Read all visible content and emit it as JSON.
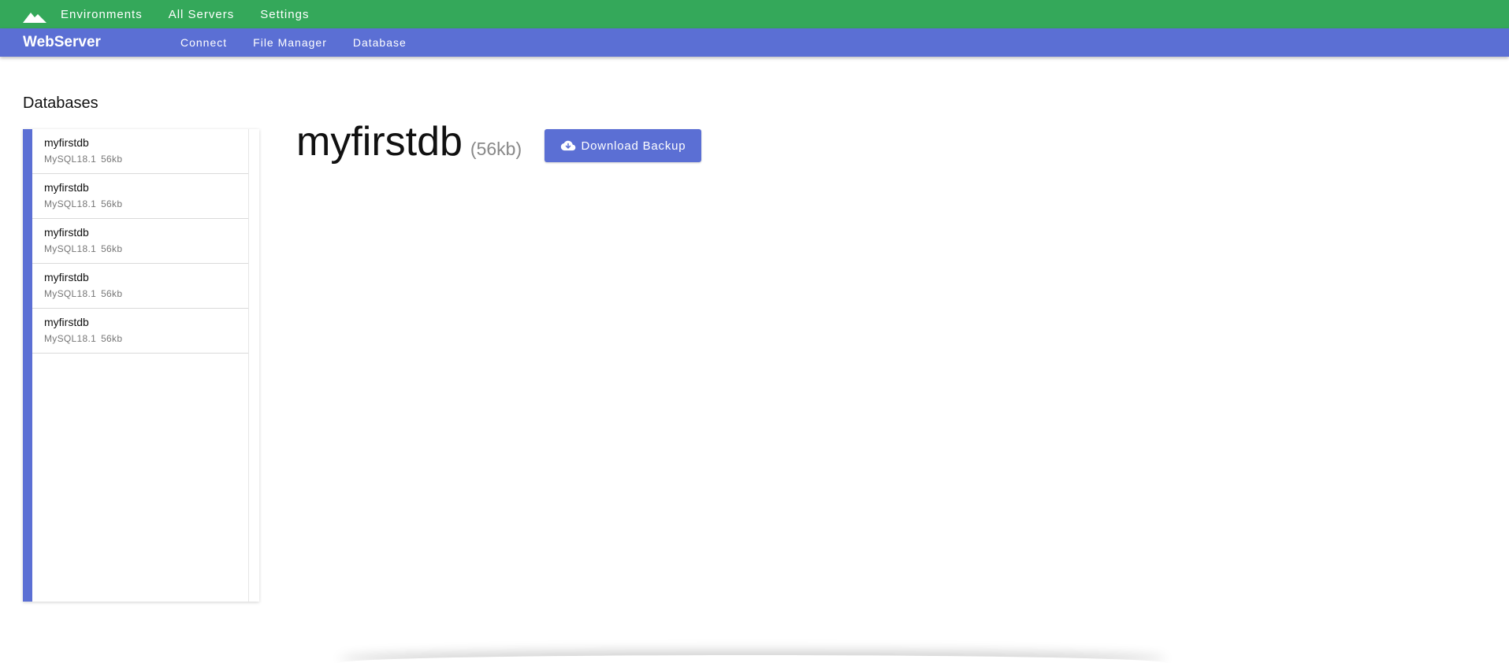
{
  "topbar": {
    "logo_icon": "mountain-icon",
    "nav": [
      "Environments",
      "All Servers",
      "Settings"
    ]
  },
  "subbar": {
    "brand": "WebServer",
    "nav": [
      "Connect",
      "File Manager",
      "Database"
    ]
  },
  "sidebar": {
    "title": "Databases",
    "items": [
      {
        "name": "myfirstdb",
        "engine": "MySQL18.1",
        "size": "56kb"
      },
      {
        "name": "myfirstdb",
        "engine": "MySQL18.1",
        "size": "56kb"
      },
      {
        "name": "myfirstdb",
        "engine": "MySQL18.1",
        "size": "56kb"
      },
      {
        "name": "myfirstdb",
        "engine": "MySQL18.1",
        "size": "56kb"
      },
      {
        "name": "myfirstdb",
        "engine": "MySQL18.1",
        "size": "56kb"
      }
    ]
  },
  "detail": {
    "name": "myfirstdb",
    "size": "(56kb)",
    "download_label": "Download Backup",
    "download_icon": "cloud-download-icon"
  },
  "colors": {
    "topbar": "#34a85a",
    "subbar": "#5b6fd4",
    "accent": "#5b6fd4"
  }
}
